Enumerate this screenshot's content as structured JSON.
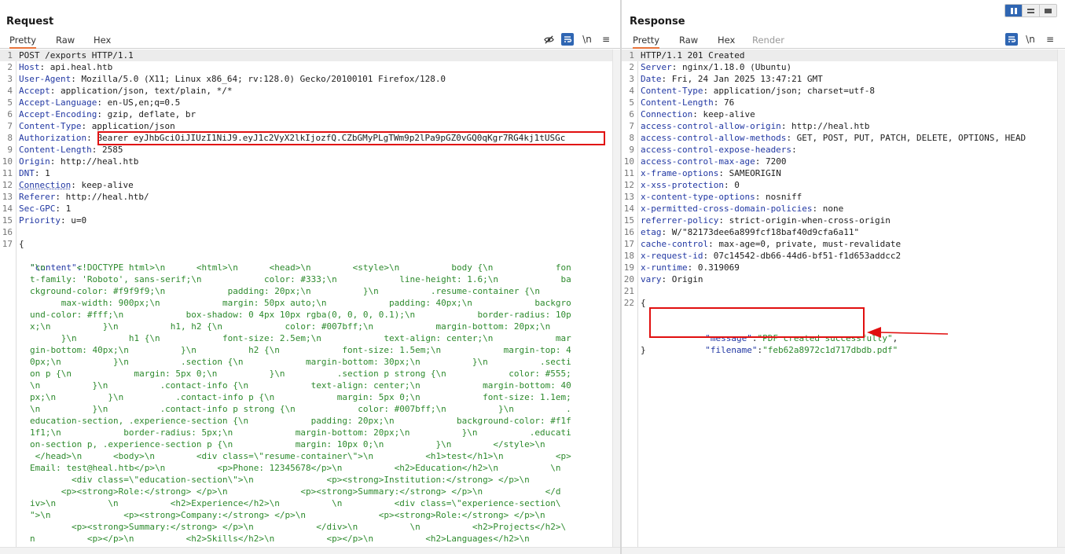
{
  "request": {
    "title": "Request",
    "tabs": [
      "Pretty",
      "Raw",
      "Hex"
    ],
    "tools": {
      "hide_icon": "eye-slash-icon",
      "wrap_icon": "word-wrap-icon",
      "newline": "\\n",
      "menu": "≡"
    },
    "lines": [
      {
        "n": "1",
        "name": "",
        "value": "POST /exports HTTP/1.1"
      },
      {
        "n": "2",
        "name": "Host",
        "value": ": api.heal.htb"
      },
      {
        "n": "3",
        "name": "User-Agent",
        "value": ": Mozilla/5.0 (X11; Linux x86_64; rv:128.0) Gecko/20100101 Firefox/128.0"
      },
      {
        "n": "4",
        "name": "Accept",
        "value": ": application/json, text/plain, */*"
      },
      {
        "n": "5",
        "name": "Accept-Language",
        "value": ": en-US,en;q=0.5"
      },
      {
        "n": "6",
        "name": "Accept-Encoding",
        "value": ": gzip, deflate, br"
      },
      {
        "n": "7",
        "name": "Content-Type",
        "value": ": application/json"
      },
      {
        "n": "8",
        "name": "Authorization",
        "value": ": Bearer eyJhbGciOiJIUzI1NiJ9.eyJ1c2VyX2lkIjozfQ.CZbGMyPLgTWm9p2lPa9pGZ0vGQ0qKgr7RG4kj1tUSGc"
      },
      {
        "n": "9",
        "name": "Content-Length",
        "value": ": 2585"
      },
      {
        "n": "10",
        "name": "Origin",
        "value": ": http://heal.htb"
      },
      {
        "n": "11",
        "name": "DNT",
        "value": ": 1"
      },
      {
        "n": "12",
        "name": "Connection",
        "value": ": keep-alive"
      },
      {
        "n": "13",
        "name": "Referer",
        "value": ": http://heal.htb/"
      },
      {
        "n": "14",
        "name": "Sec-GPC",
        "value": ": 1"
      },
      {
        "n": "15",
        "name": "Priority",
        "value": ": u=0"
      },
      {
        "n": "16",
        "name": "",
        "value": ""
      },
      {
        "n": "17",
        "name": "",
        "value": "{"
      }
    ],
    "body_key": "\"content\":",
    "body_wrapped": [
      "\"\\n      <!DOCTYPE html>\\n      <html>\\n      <head>\\n        <style>\\n          body {\\n            fon",
      "t-family: 'Roboto', sans-serif;\\n            color: #333;\\n            line-height: 1.6;\\n            ba",
      "ckground-color: #f9f9f9;\\n            padding: 20px;\\n          }\\n          .resume-container {\\n",
      "      max-width: 900px;\\n            margin: 50px auto;\\n            padding: 40px;\\n            backgro",
      "und-color: #fff;\\n            box-shadow: 0 4px 10px rgba(0, 0, 0, 0.1);\\n            border-radius: 10p",
      "x;\\n          }\\n          h1, h2 {\\n            color: #007bff;\\n            margin-bottom: 20px;\\n",
      "      }\\n          h1 {\\n            font-size: 2.5em;\\n            text-align: center;\\n            mar",
      "gin-bottom: 40px;\\n          }\\n          h2 {\\n            font-size: 1.5em;\\n            margin-top: 4",
      "0px;\\n          }\\n          .section {\\n            margin-bottom: 30px;\\n          }\\n          .secti",
      "on p {\\n            margin: 5px 0;\\n          }\\n          .section p strong {\\n            color: #555;",
      "\\n          }\\n          .contact-info {\\n            text-align: center;\\n            margin-bottom: 40",
      "px;\\n          }\\n          .contact-info p {\\n            margin: 5px 0;\\n            font-size: 1.1em;",
      "\\n          }\\n          .contact-info p strong {\\n            color: #007bff;\\n          }\\n          .",
      "education-section, .experience-section {\\n            padding: 20px;\\n            background-color: #f1f",
      "1f1;\\n            border-radius: 5px;\\n            margin-bottom: 20px;\\n          }\\n          .educati",
      "on-section p, .experience-section p {\\n            margin: 10px 0;\\n          }\\n        </style>\\n",
      " </head>\\n      <body>\\n        <div class=\\\"resume-container\\\">\\n          <h1>test</h1>\\n          <p>",
      "Email: test@heal.htb</p>\\n          <p>Phone: 12345678</p>\\n          <h2>Education</h2>\\n          \\n",
      "        <div class=\\\"education-section\\\">\\n              <p><strong>Institution:</strong> </p>\\n",
      "      <p><strong>Role:</strong> </p>\\n              <p><strong>Summary:</strong> </p>\\n            </d",
      "iv>\\n          \\n          <h2>Experience</h2>\\n          \\n          <div class=\\\"experience-section\\",
      "\">\\n              <p><strong>Company:</strong> </p>\\n              <p><strong>Role:</strong> </p>\\n",
      "        <p><strong>Summary:</strong> </p>\\n            </div>\\n          \\n          <h2>Projects</h2>\\",
      "n          <p></p>\\n          <h2>Skills</h2>\\n          <p></p>\\n          <h2>Languages</h2>\\n"
    ]
  },
  "response": {
    "title": "Response",
    "tabs": [
      "Pretty",
      "Raw",
      "Hex",
      "Render"
    ],
    "tools": {
      "wrap_icon": "word-wrap-icon",
      "newline": "\\n",
      "menu": "≡"
    },
    "lines": [
      {
        "n": "1",
        "name": "",
        "value": "HTTP/1.1 201 Created"
      },
      {
        "n": "2",
        "name": "Server",
        "value": ": nginx/1.18.0 (Ubuntu)"
      },
      {
        "n": "3",
        "name": "Date",
        "value": ": Fri, 24 Jan 2025 13:47:21 GMT"
      },
      {
        "n": "4",
        "name": "Content-Type",
        "value": ": application/json; charset=utf-8"
      },
      {
        "n": "5",
        "name": "Content-Length",
        "value": ": 76"
      },
      {
        "n": "6",
        "name": "Connection",
        "value": ": keep-alive"
      },
      {
        "n": "7",
        "name": "access-control-allow-origin",
        "value": ": http://heal.htb"
      },
      {
        "n": "8",
        "name": "access-control-allow-methods",
        "value": ": GET, POST, PUT, PATCH, DELETE, OPTIONS, HEAD"
      },
      {
        "n": "9",
        "name": "access-control-expose-headers",
        "value": ":"
      },
      {
        "n": "10",
        "name": "access-control-max-age",
        "value": ": 7200"
      },
      {
        "n": "11",
        "name": "x-frame-options",
        "value": ": SAMEORIGIN"
      },
      {
        "n": "12",
        "name": "x-xss-protection",
        "value": ": 0"
      },
      {
        "n": "13",
        "name": "x-content-type-options",
        "value": ": nosniff"
      },
      {
        "n": "14",
        "name": "x-permitted-cross-domain-policies",
        "value": ": none"
      },
      {
        "n": "15",
        "name": "referrer-policy",
        "value": ": strict-origin-when-cross-origin"
      },
      {
        "n": "16",
        "name": "etag",
        "value": ": W/\"82173dee6a899fcf18baf40d9cfa6a11\""
      },
      {
        "n": "17",
        "name": "cache-control",
        "value": ": max-age=0, private, must-revalidate"
      },
      {
        "n": "18",
        "name": "x-request-id",
        "value": ": 07c14542-db66-44d6-bf51-f1d653addcc2"
      },
      {
        "n": "19",
        "name": "x-runtime",
        "value": ": 0.319069"
      },
      {
        "n": "20",
        "name": "vary",
        "value": ": Origin"
      },
      {
        "n": "21",
        "name": "",
        "value": ""
      },
      {
        "n": "22",
        "name": "",
        "value": "{"
      }
    ],
    "json_lines": [
      {
        "key": "\"message\"",
        "sep": ":",
        "val": "\"PDF created successfully\"",
        "end": ","
      },
      {
        "key": "\"filename\"",
        "sep": ":",
        "val": "\"feb62a8972c1d717dbdb.pdf\"",
        "end": ""
      }
    ],
    "close": "}"
  },
  "layout_toggle_icons": [
    "split-horizontal-icon",
    "split-vertical-icon",
    "single-pane-icon"
  ],
  "colors": {
    "highlight_box": "#e10f0f",
    "accent_tab": "#e8743b",
    "header_name": "#2238a3",
    "json_string": "#2d8a2d",
    "toolbar_blue": "#2f66b3"
  }
}
